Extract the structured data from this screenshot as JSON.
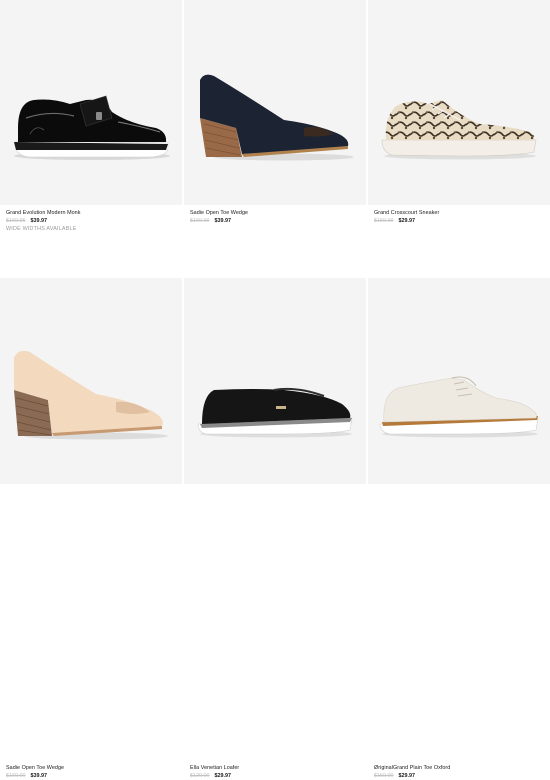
{
  "products": [
    {
      "name": "Grand Evolution Modern Monk",
      "original_price": "$169.95",
      "sale_price": "$39.97",
      "note": "WIDE WIDTHS AVAILABLE"
    },
    {
      "name": "Sadie Open Toe Wedge",
      "original_price": "$160.00",
      "sale_price": "$39.97"
    },
    {
      "name": "Grand Crosscourt Sneaker",
      "original_price": "$150.00",
      "sale_price": "$29.97"
    },
    {
      "name": "Sadie Open Toe Wedge",
      "original_price": "$160.00",
      "sale_price": "$39.97"
    },
    {
      "name": "Ella Venetian Loafer",
      "original_price": "$120.00",
      "sale_price": "$29.97"
    },
    {
      "name": "ØriginalGrand Plain Toe Oxford",
      "original_price": "$150.00",
      "sale_price": "$29.97"
    }
  ],
  "colors": {
    "image_background": "#f4f4f4",
    "price_old": "#c3c3c3",
    "price_new": "#1a1a1a",
    "note": "#9a9a9a"
  }
}
